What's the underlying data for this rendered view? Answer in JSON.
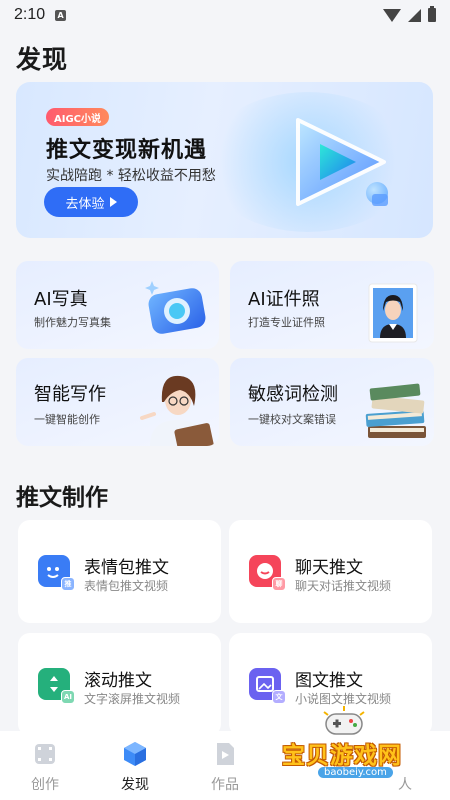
{
  "status_bar": {
    "time": "2:10",
    "notification": "A"
  },
  "page": {
    "title": "发现"
  },
  "banner": {
    "tag": "AIGC小说",
    "title": "推文变现新机遇",
    "subtitle": "实战陪跑 * 轻松收益不用愁",
    "button": "去体验"
  },
  "tools": [
    {
      "title": "AI写真",
      "desc": "制作魅力写真集",
      "icon": "camera-icon"
    },
    {
      "title": "AI证件照",
      "desc": "打造专业证件照",
      "icon": "id-photo-icon"
    },
    {
      "title": "智能写作",
      "desc": "一键智能创作",
      "icon": "writer-avatar-icon"
    },
    {
      "title": "敏感词检测",
      "desc": "一键校对文案错误",
      "icon": "books-icon"
    }
  ],
  "section": {
    "title": "推文制作"
  },
  "tuiwen": [
    {
      "title": "表情包推文",
      "desc": "表情包推文视频",
      "icon": "emoji-icon",
      "badge": "推",
      "color": "#3a7cf5"
    },
    {
      "title": "聊天推文",
      "desc": "聊天对话推文视频",
      "icon": "chat-icon",
      "badge": "聊",
      "color": "#f5455a"
    },
    {
      "title": "滚动推文",
      "desc": "文字滚屏推文视频",
      "icon": "scroll-icon",
      "badge": "AI",
      "color": "#25b07c"
    },
    {
      "title": "图文推文",
      "desc": "小说图文推文视频",
      "icon": "image-text-icon",
      "badge": "文",
      "color": "#6b62f0"
    }
  ],
  "tabbar": [
    {
      "label": "创作",
      "icon": "film-icon",
      "active": false
    },
    {
      "label": "发现",
      "icon": "cube-icon",
      "active": true
    },
    {
      "label": "作品",
      "icon": "play-file-icon",
      "active": false
    },
    {
      "label": "",
      "icon": "",
      "active": false
    },
    {
      "label": "人",
      "icon": "person-icon",
      "active": false
    }
  ],
  "watermark": {
    "text": "宝贝游戏网",
    "url": "baobeiy.com"
  },
  "colors": {
    "accent": "#2f6df6",
    "tag_start": "#ff5a6e",
    "tag_end": "#ff8a5c"
  }
}
